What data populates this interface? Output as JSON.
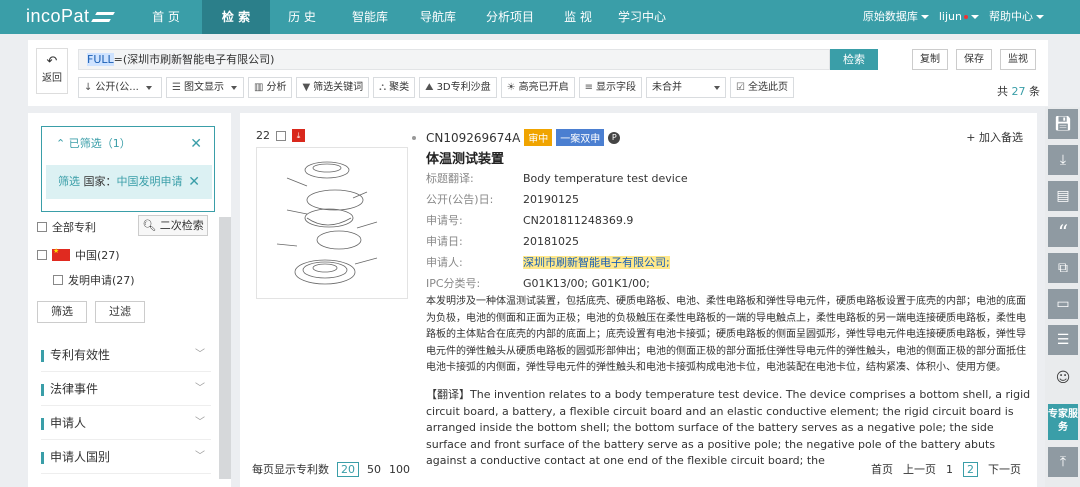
{
  "header": {
    "logo": "incoPat",
    "nav": [
      "首 页",
      "检 索",
      "历 史",
      "智能库",
      "导航库",
      "分析项目",
      "监 视",
      "学习中心"
    ],
    "active_nav": "检 索",
    "db_label": "原始数据库",
    "user": "lijun",
    "help": "帮助中心"
  },
  "toolbar": {
    "back": "返回",
    "query_field": "FULL",
    "query_rest": "=(深圳市刷新智能电子有限公司)",
    "search": "检索",
    "copy": "复制",
    "save": "保存",
    "monitor": "监视",
    "tools": [
      "公开(公...",
      "图文显示",
      "分析",
      "筛选关键词",
      "聚类",
      "3D专利沙盘",
      "高亮已开启",
      "显示字段",
      "未合并",
      "全选此页"
    ],
    "total_prefix": "共",
    "total_count": "27",
    "total_suffix": "条"
  },
  "sidebar": {
    "filtered_label": "已筛选（1）",
    "chip_key": "筛选",
    "chip_label": "国家：",
    "chip_value": "中国发明申请",
    "all_patents": "全部专利",
    "secondary_search": "二次检索",
    "china": "中国(27)",
    "invention": "发明申请(27)",
    "filter_btn": "筛选",
    "exclude_btn": "过滤",
    "facets": [
      "专利有效性",
      "法律事件",
      "申请人",
      "申请人国别"
    ]
  },
  "result": {
    "index": "22",
    "pn": "CN109269674A",
    "tag_review": "审中",
    "tag_dual": "一案双申",
    "add_fav": "+ 加入备选",
    "title": "体温测试装置",
    "fields": [
      {
        "k": "标题翻译:",
        "v": "Body temperature test device"
      },
      {
        "k": "公开(公告)日:",
        "v": "20190125"
      },
      {
        "k": "申请号:",
        "v": "CN201811248369.9"
      },
      {
        "k": "申请日:",
        "v": "20181025"
      },
      {
        "k": "申请人:",
        "v": "深圳市刷新智能电子有限公司;"
      },
      {
        "k": "IPC分类号:",
        "v": "G01K13/00; G01K1/00;"
      }
    ],
    "abstract": "本发明涉及一种体温测试装置，包括底壳、硬质电路板、电池、柔性电路板和弹性导电元件，硬质电路板设置于底壳的内部；电池的底面为负极，电池的侧面和正面为正极；电池的负极触压在柔性电路板的一端的导电触点上，柔性电路板的另一端电连接硬质电路板，柔性电路板的主体贴合在底壳的内部的底面上；底壳设置有电池卡接弧；硬质电路板的侧面呈圆弧形，弹性导电元件电连接硬质电路板，弹性导电元件的弹性触头从硬质电路板的圆弧形部伸出；电池的侧面正极的部分面抵住弹性导电元件的弹性触头，电池的侧面正极的部分面抵住电池卡接弧的内侧面，弹性导电元件的弹性触头和电池卡接弧构成电池卡位，电池装配在电池卡位，结构紧凑、体积小、使用方便。",
    "translation": "【翻译】The invention relates to a body temperature test device. The device comprises a bottom shell, a rigid circuit board, a battery, a flexible circuit board and an elastic conductive element; the rigid circuit board is arranged inside the bottom shell; the bottom surface of the battery serves as a negative pole; the side surface and front surface of the battery serve as a positive pole; the negative pole of the battery abuts against a conductive contact at one end of the flexible circuit board; the"
  },
  "pagination": {
    "per_page_label": "每页显示专利数",
    "sizes": [
      "20",
      "50",
      "100"
    ],
    "first": "首页",
    "prev": "上一页",
    "pages": [
      "1",
      "2"
    ],
    "current_page": "2",
    "next": "下一页"
  },
  "right_tools": {
    "expert_label": "专家服务"
  },
  "colors": {
    "accent": "#3a9ea8",
    "nav_active": "#2b7f8a",
    "tag_review": "#f0a400",
    "tag_dual": "#4b7fd1"
  }
}
